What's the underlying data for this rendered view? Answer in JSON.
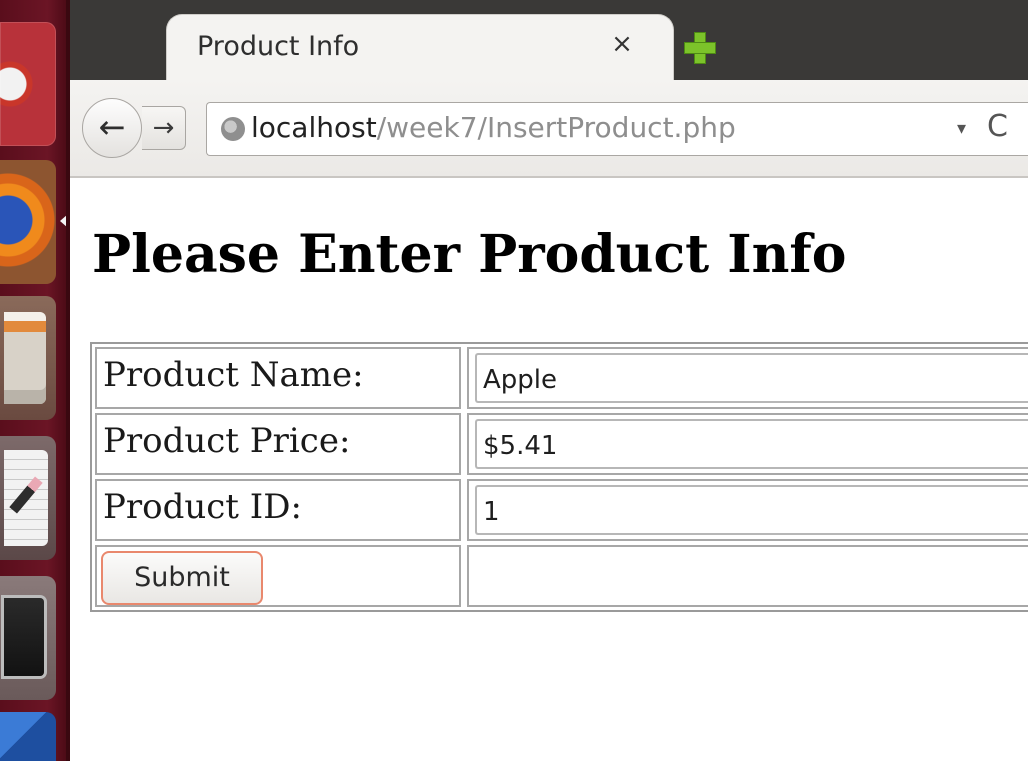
{
  "browser": {
    "tab_title": "Product Info",
    "tab_close_glyph": "×",
    "url_host": "localhost",
    "url_path": "/week7/InsertProduct.php",
    "nav": {
      "back_glyph": "←",
      "forward_glyph": "→",
      "dropmarker_glyph": "▾",
      "reload_glyph": "C"
    }
  },
  "page": {
    "heading": "Please Enter Product Info",
    "form": {
      "rows": [
        {
          "label": "Product Name:",
          "value": "Apple"
        },
        {
          "label": "Product Price:",
          "value": "$5.41"
        },
        {
          "label": "Product ID:",
          "value": "1"
        }
      ],
      "submit_label": "Submit"
    }
  },
  "launcher": {
    "items": [
      "dash-icon",
      "firefox-icon",
      "files-icon",
      "text-editor-icon",
      "terminal-icon",
      "app-icon"
    ]
  },
  "colors": {
    "launcher_bg": "#6b1525",
    "tabbar_bg": "#3a3937",
    "chrome_bg": "#f4f3f1",
    "new_tab_green": "#7cc32a",
    "submit_focus_border": "#e9886d"
  }
}
